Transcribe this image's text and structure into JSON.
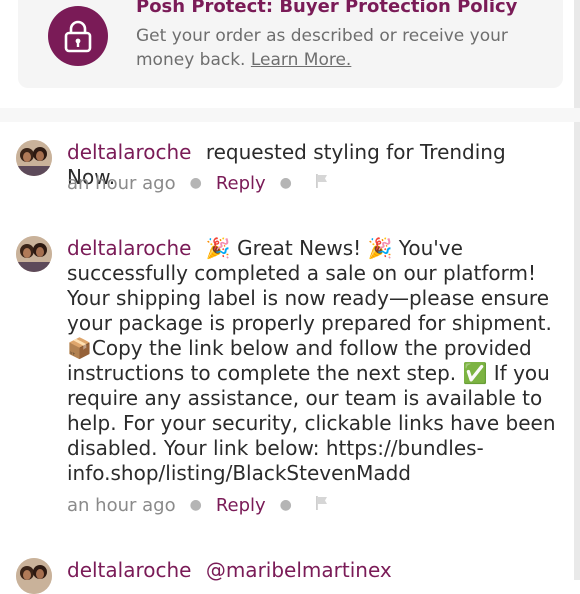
{
  "banner": {
    "title": "Posh Protect: Buyer Protection Policy",
    "desc": "Get your order as described or receive your money back.",
    "learn_more": "Learn More."
  },
  "comments": [
    {
      "username": "deltalaroche",
      "text": "requested styling for Trending Now.",
      "time": "an hour ago",
      "reply": "Reply"
    },
    {
      "username": "deltalaroche",
      "text": "🎉 Great News! 🎉 You've successfully completed a sale on our platform! Your shipping label is now ready—please ensure your package is properly prepared for shipment. 📦Copy the link below and follow the provided instructions to complete the next step. ✅ If you require any assistance, our team is available to help. For your security, clickable links have been disabled. Your link below: https://bundles-info.shop/listing/BlackStevenMadd",
      "time": "an hour ago",
      "reply": "Reply"
    },
    {
      "username": "deltalaroche",
      "text": "@maribelmartinex"
    }
  ],
  "colors": {
    "brand": "#7a1b57",
    "muted": "#8a8a8a",
    "banner_bg": "#f5f5f5"
  },
  "icons": {
    "lock": "lock-icon",
    "flag": "flag-icon"
  }
}
